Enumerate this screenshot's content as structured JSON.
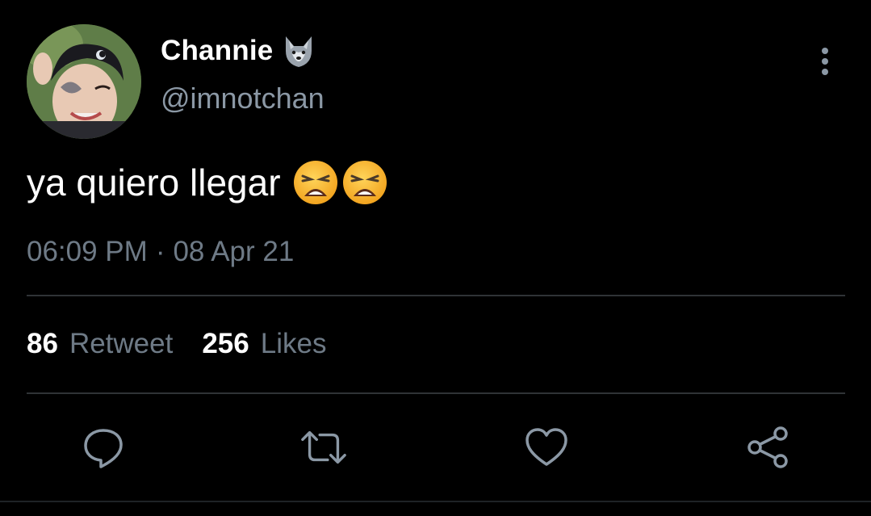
{
  "user": {
    "display_name": "Channie",
    "handle": "@imnotchan",
    "name_emoji": "wolf-face-icon"
  },
  "tweet": {
    "text": "ya quiero llegar",
    "emojis": [
      "weary-face-icon",
      "weary-face-icon"
    ],
    "time": "06:09 PM",
    "separator": "·",
    "date": "08 Apr 21"
  },
  "stats": {
    "retweets_count": "86",
    "retweets_label": "Retweet",
    "likes_count": "256",
    "likes_label": "Likes"
  },
  "actions": [
    "reply-icon",
    "retweet-icon",
    "like-icon",
    "share-icon"
  ],
  "colors": {
    "background": "#000000",
    "primary_text": "#ffffff",
    "secondary_text": "#6e7a86",
    "handle_text": "#8b98a5",
    "divider": "#2f3336",
    "icon": "#8b98a5"
  }
}
